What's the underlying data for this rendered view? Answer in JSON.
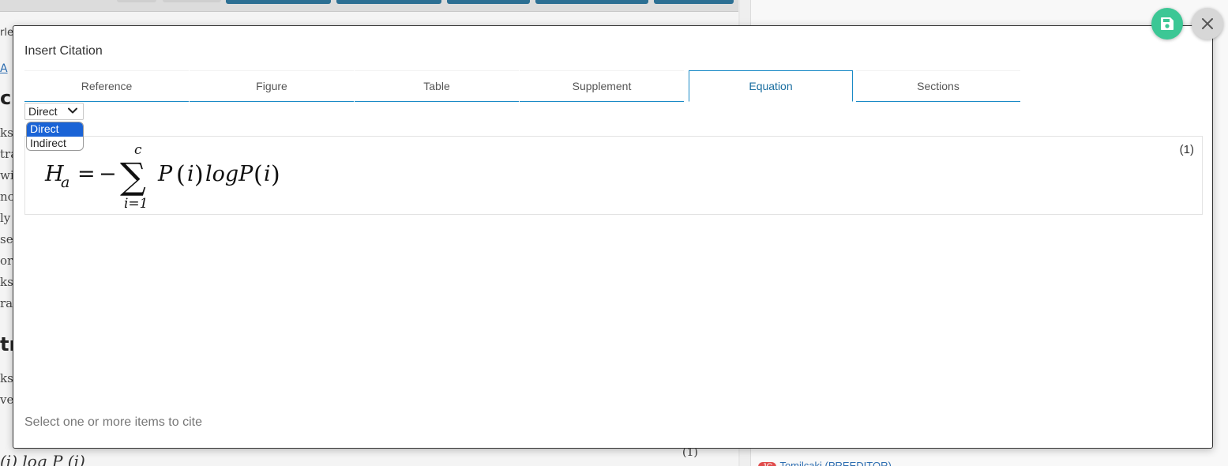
{
  "background": {
    "left_fragments": [
      "rle",
      "A",
      "ch",
      "ks",
      "tra",
      "wit",
      "nc",
      "ly",
      "sev",
      "ora",
      "ks",
      "ra",
      "tr",
      "ks a",
      "ver"
    ],
    "bottom_equation": "(i) log P (i)",
    "bottom_equation_number": "(1)",
    "editor_tag": {
      "badge": "JC",
      "name": "Tomilcaki (PREEDITOR)"
    }
  },
  "modal": {
    "title": "Insert Citation",
    "tabs": [
      {
        "label": "Reference"
      },
      {
        "label": "Figure"
      },
      {
        "label": "Table"
      },
      {
        "label": "Supplement"
      },
      {
        "label": "Equation",
        "active": true
      },
      {
        "label": "Sections"
      }
    ],
    "citation_type": {
      "selected": "Direct",
      "options": [
        "Direct",
        "Indirect"
      ]
    },
    "equation": {
      "number": "(1)",
      "H": "H",
      "sub_a": "a",
      "equals": "=",
      "minus": "−",
      "sigma": "∑",
      "upper": "c",
      "lower": "i=1",
      "P1": "P",
      "lp1": "(",
      "i1": "i",
      "rp1": ")",
      "log": "logP",
      "lp2": "(",
      "i2": "i",
      "rp2": ")"
    },
    "footer_hint": "Select one or more items to cite"
  },
  "actions": {
    "save_icon": "save-icon",
    "close_icon": "close-icon"
  },
  "colors": {
    "accent": "#1a8ac6",
    "save_button": "#3cc795",
    "close_button": "#d7d7d7",
    "selected_option": "#1a63d6"
  }
}
